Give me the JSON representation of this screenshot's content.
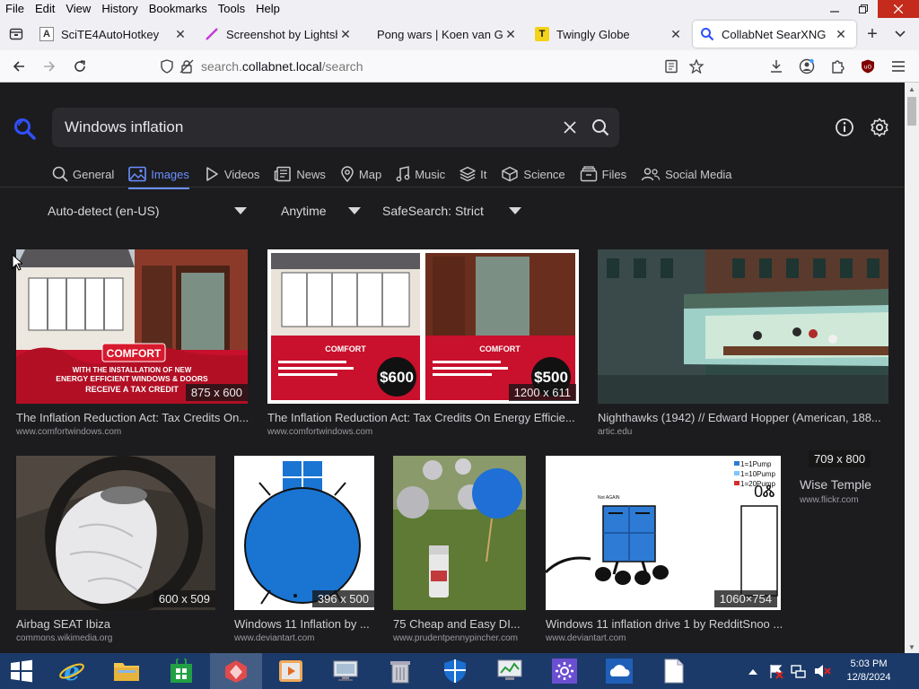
{
  "menu": [
    "File",
    "Edit",
    "View",
    "History",
    "Bookmarks",
    "Tools",
    "Help"
  ],
  "tabs": [
    {
      "title": "SciTE4AutoHotkey",
      "favicon": "A"
    },
    {
      "title": "Screenshot by Lightshot",
      "favicon": ""
    },
    {
      "title": "Pong wars | Koen van Gilst",
      "favicon": ""
    },
    {
      "title": "Twingly Globe",
      "favicon": "T"
    },
    {
      "title": "CollabNet SearXNG",
      "favicon": ""
    }
  ],
  "url": {
    "prefix": "search.",
    "domain": "collabnet.local",
    "path": "/search"
  },
  "search": {
    "query": "Windows inflation"
  },
  "categories": [
    {
      "label": "General",
      "icon": "search-icon"
    },
    {
      "label": "Images",
      "icon": "image-icon"
    },
    {
      "label": "Videos",
      "icon": "play-icon"
    },
    {
      "label": "News",
      "icon": "newspaper-icon"
    },
    {
      "label": "Map",
      "icon": "pin-icon"
    },
    {
      "label": "Music",
      "icon": "music-icon"
    },
    {
      "label": "It",
      "icon": "layers-icon"
    },
    {
      "label": "Science",
      "icon": "cube-icon"
    },
    {
      "label": "Files",
      "icon": "files-icon"
    },
    {
      "label": "Social Media",
      "icon": "people-icon"
    }
  ],
  "filters": {
    "language": "Auto-detect (en-US)",
    "time": "Anytime",
    "safesearch": "SafeSearch: Strict"
  },
  "results": [
    {
      "title": "The Inflation Reduction Act: Tax Credits On...",
      "source": "www.comfortwindows.com",
      "dim": "875 x 600",
      "banner": [
        "COMFORT",
        "WITH THE INSTALLATION OF NEW",
        "ENERGY EFFICIENT WINDOWS & DOORS",
        "RECEIVE A TAX CREDIT"
      ]
    },
    {
      "title": "The Inflation Reduction Act: Tax Credits On Energy Efficie...",
      "source": "www.comfortwindows.com",
      "dim": "1200 x 611",
      "amounts": [
        "$600",
        "$500"
      ],
      "brand": "COMFORT"
    },
    {
      "title": "Nighthawks (1942) // Edward Hopper (American, 188...",
      "source": "artic.edu",
      "dim": ""
    },
    {
      "title": "Airbag SEAT Ibiza",
      "source": "commons.wikimedia.org",
      "dim": "600 x 509"
    },
    {
      "title": "Windows 11 Inflation by ...",
      "source": "www.deviantart.com",
      "dim": "396 x 500"
    },
    {
      "title": "75 Cheap and Easy DI...",
      "source": "www.prudentpennypincher.com",
      "dim": ""
    },
    {
      "title": "Windows 11 inflation drive 1 by RedditSnoo ...",
      "source": "www.deviantart.com",
      "dim": "1060×754",
      "legend": [
        "1=1Pump",
        "1=10Pump",
        "1=20Pump"
      ]
    },
    {
      "title": "Wise Temple",
      "source": "www.flickr.com",
      "dim": "709 x 800"
    }
  ],
  "taskbar": {
    "time": "5:03 PM",
    "date": "12/8/2024"
  },
  "colors": {
    "accent": "#6a8fff",
    "page_bg": "#1c1c1e",
    "taskbar": "#1b3a69"
  }
}
